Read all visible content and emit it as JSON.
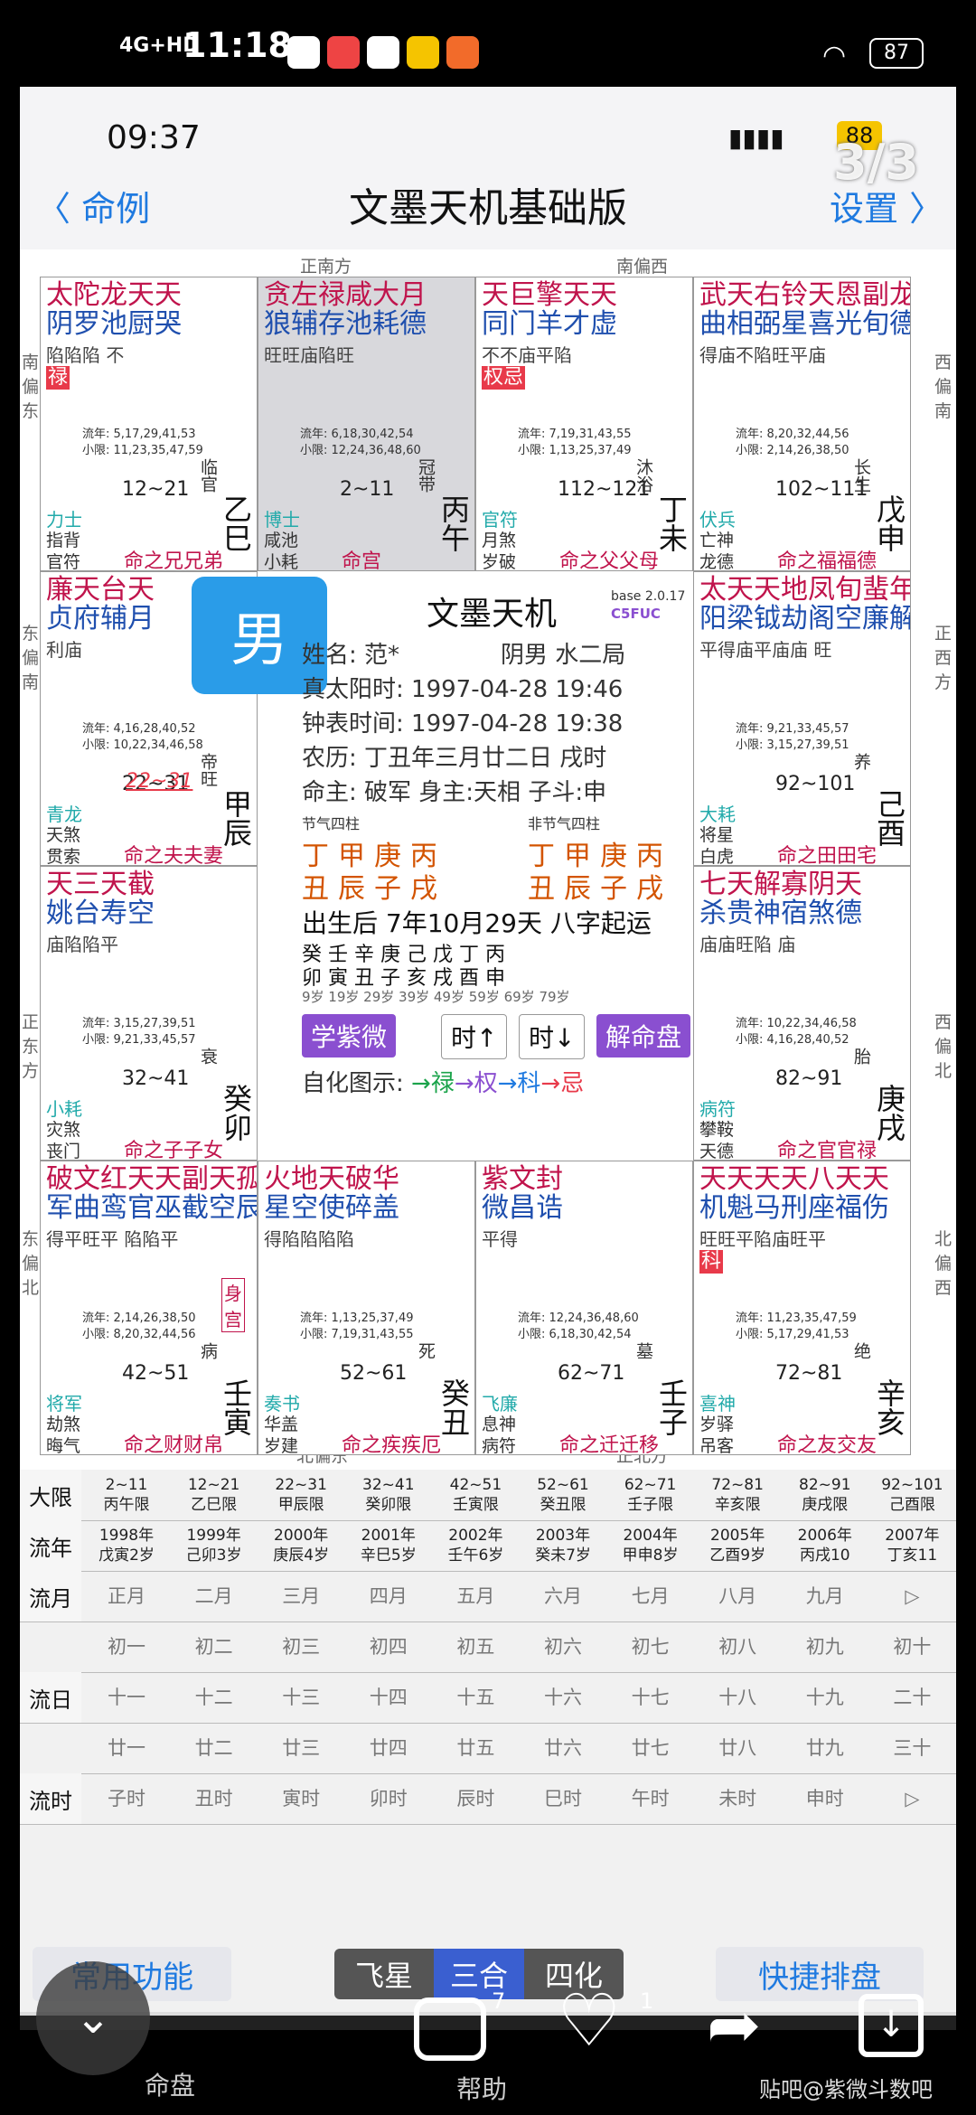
{
  "status_bar": {
    "network": "4G+HD",
    "time": "11:18",
    "battery": "87"
  },
  "inner_status": {
    "time": "09:37",
    "battery": "88",
    "page_counter": "3/3"
  },
  "nav": {
    "back_label": "命例",
    "title": "文墨天机基础版",
    "settings_label": "设置"
  },
  "directions": {
    "top_left": "正南方",
    "top_right": "南偏西",
    "left_top": "南偏东",
    "right_top": "西偏南",
    "left_mid_top": "东偏南",
    "right_mid_top": "正西方",
    "left_mid_bottom": "正东方",
    "right_mid_bottom": "西偏北",
    "left_bottom": "东偏北",
    "right_bottom": "北偏西",
    "bottom_left": "北偏东",
    "bottom_right": "正北方"
  },
  "gender_badge": "男",
  "palaces": [
    {
      "stars": "太陀龙天天",
      "stars2": "阴罗池厨哭",
      "bright": "陷陷陷   不",
      "hua": "禄",
      "y1": "流年: 5,17,29,41,53",
      "y2": "小限: 11,23,35,47,59",
      "range": "12~21",
      "g1": "力士",
      "g2": "指背",
      "g3": "官符",
      "palace": "命之兄兄弟",
      "stage": "临官",
      "sb": "乙巳"
    },
    {
      "stars": "贪左禄咸大月",
      "stars2": "狼辅存池耗德",
      "bright": "旺旺庙陷旺",
      "hua": "",
      "y1": "流年: 6,18,30,42,54",
      "y2": "小限: 12,24,36,48,60",
      "range": "2~11",
      "g1": "博士",
      "g2": "咸池",
      "g3": "小耗",
      "palace": "命宫",
      "stage": "冠带",
      "sb": "丙午"
    },
    {
      "stars": "天巨擎天天",
      "stars2": "同门羊才虚",
      "bright": "不不庙平陷",
      "hua": "权忌",
      "y1": "流年: 7,19,31,43,55",
      "y2": "小限: 1,13,25,37,49",
      "range": "112~121",
      "g1": "官符",
      "g2": "月煞",
      "g3": "岁破",
      "palace": "命之父父母",
      "stage": "沐浴",
      "sb": "丁未"
    },
    {
      "stars": "武天右铃天恩副龙",
      "stars2": "曲相弼星喜光旬德",
      "bright": "得庙不陷旺平庙",
      "hua": "",
      "y1": "流年: 8,20,32,44,56",
      "y2": "小限: 2,14,26,38,50",
      "range": "102~111",
      "g1": "伏兵",
      "g2": "亡神",
      "g3": "龙德",
      "palace": "命之福福德",
      "stage": "长生",
      "sb": "戊申"
    },
    {
      "stars": "廉天台天",
      "stars2": "贞府辅月",
      "bright": "利庙",
      "hua": "",
      "y1": "流年: 4,16,28,40,52",
      "y2": "小限: 10,22,34,46,58",
      "range": "22~31",
      "g1": "青龙",
      "g2": "天煞",
      "g3": "贯索",
      "palace": "命之夫夫妻",
      "stage": "帝旺",
      "sb": "甲辰"
    },
    {
      "stars": "太天天地凤旬蜚年",
      "stars2": "阳梁钺劫阁空廉解",
      "bright": "平得庙平庙庙   旺",
      "hua": "",
      "y1": "流年: 9,21,33,45,57",
      "y2": "小限: 3,15,27,39,51",
      "range": "92~101",
      "g1": "大耗",
      "g2": "将星",
      "g3": "白虎",
      "palace": "命之田田宅",
      "stage": "养",
      "sb": "己酉"
    },
    {
      "stars": "天三天截",
      "stars2": "姚台寿空",
      "bright": "庙陷陷平",
      "hua": "",
      "y1": "流年: 3,15,27,39,51",
      "y2": "小限: 9,21,33,45,57",
      "range": "32~41",
      "g1": "小耗",
      "g2": "灾煞",
      "g3": "丧门",
      "palace": "命之子子女",
      "stage": "衰",
      "sb": "癸卯"
    },
    {
      "stars": "七天解寡阴天",
      "stars2": "杀贵神宿煞德",
      "bright": "庙庙旺陷   庙",
      "hua": "",
      "y1": "流年: 10,22,34,46,58",
      "y2": "小限: 4,16,28,40,52",
      "range": "82~91",
      "g1": "病符",
      "g2": "攀鞍",
      "g3": "天德",
      "palace": "命之官官禄",
      "stage": "胎",
      "sb": "庚戌"
    },
    {
      "stars": "破文红天天副天孤劫",
      "stars2": "军曲鸾官巫截空辰煞",
      "bright": "得平旺平   陷陷平",
      "hua": "",
      "y1": "流年: 2,14,26,38,50",
      "y2": "小限: 8,20,32,44,56",
      "range": "42~51",
      "g1": "将军",
      "g2": "劫煞",
      "g3": "晦气",
      "palace": "命之财财帛",
      "stage": "病",
      "sb": "壬寅"
    },
    {
      "stars": "火地天破华",
      "stars2": "星空使碎盖",
      "bright": "得陷陷陷陷",
      "hua": "",
      "y1": "流年: 1,13,25,37,49",
      "y2": "小限: 7,19,31,43,55",
      "range": "52~61",
      "g1": "奏书",
      "g2": "华盖",
      "g3": "岁建",
      "palace": "命之疾疾厄",
      "stage": "死",
      "sb": "癸丑"
    },
    {
      "stars": "紫文封",
      "stars2": "微昌诰",
      "bright": "平得",
      "hua": "",
      "y1": "流年: 12,24,36,48,60",
      "y2": "小限: 6,18,30,42,54",
      "range": "62~71",
      "g1": "飞廉",
      "g2": "息神",
      "g3": "病符",
      "palace": "命之迁迁移",
      "stage": "墓",
      "sb": "壬子"
    },
    {
      "stars": "天天天天八天天",
      "stars2": "机魁马刑座福伤",
      "bright": "旺旺平陷庙旺平",
      "hua": "科",
      "y1": "流年: 11,23,35,47,59",
      "y2": "小限: 5,17,29,41,53",
      "range": "72~81",
      "g1": "喜神",
      "g2": "岁驿",
      "g3": "吊客",
      "palace": "命之友交友",
      "stage": "绝",
      "sb": "辛亥"
    }
  ],
  "shen_gong": "身宫",
  "daxian_marker": "22~31",
  "center": {
    "app": "文墨天机",
    "version": "base 2.0.17",
    "code": "C5FUC",
    "name": "姓名: 范*",
    "yinyang": "阴男 水二局",
    "true_solar": "真太阳时: 1997-04-28  19:46",
    "clock": "钟表时间: 1997-04-28  19:38",
    "lunar": "农历: 丁丑年三月廿二日 戌时",
    "master": "命主: 破军 身主:天相  子斗:申",
    "pillars_title_left": "节气四柱",
    "pillars_title_right": "非节气四柱",
    "pillars_top": "丁甲庚丙",
    "pillars_bottom": "丑辰子戌",
    "pillars2_top": "丁甲庚丙",
    "pillars2_bottom": "丑辰子戌",
    "luck_start": "出生后 7年10月29天 八字起运",
    "luck_row_top": "癸 壬 辛 庚 己 戊 丁 丙",
    "luck_row_bottom": "卯 寅 丑 子 亥 戌 酉 申",
    "luck_ages": "9岁  19岁  29岁  39岁  49岁  59岁  69岁  79岁",
    "btn_learn": "学紫微",
    "btn_up": "时↑",
    "btn_down": "时↓",
    "btn_decode": "解命盘",
    "legend_label": "自化图示:",
    "legend_lu": "→禄",
    "legend_quan": "→权",
    "legend_ke": "→科",
    "legend_ji": "→忌"
  },
  "table": {
    "daxian_label": "大限",
    "daxian": [
      [
        "2~11",
        "丙午限"
      ],
      [
        "12~21",
        "乙巳限"
      ],
      [
        "22~31",
        "甲辰限"
      ],
      [
        "32~41",
        "癸卯限"
      ],
      [
        "42~51",
        "壬寅限"
      ],
      [
        "52~61",
        "癸丑限"
      ],
      [
        "62~71",
        "壬子限"
      ],
      [
        "72~81",
        "辛亥限"
      ],
      [
        "82~91",
        "庚戌限"
      ],
      [
        "92~101",
        "己酉限"
      ]
    ],
    "liunian_label": "流年",
    "liunian": [
      [
        "1998年",
        "戊寅2岁"
      ],
      [
        "1999年",
        "己卯3岁"
      ],
      [
        "2000年",
        "庚辰4岁"
      ],
      [
        "2001年",
        "辛巳5岁"
      ],
      [
        "2002年",
        "壬午6岁"
      ],
      [
        "2003年",
        "癸未7岁"
      ],
      [
        "2004年",
        "甲申8岁"
      ],
      [
        "2005年",
        "乙酉9岁"
      ],
      [
        "2006年",
        "丙戌10"
      ],
      [
        "2007年",
        "丁亥11"
      ]
    ],
    "liuyue_label": "流月",
    "liuyue": [
      "正月",
      "二月",
      "三月",
      "四月",
      "五月",
      "六月",
      "七月",
      "八月",
      "九月",
      "▷"
    ],
    "liuri_label": "流日",
    "liuri_1": [
      "初一",
      "初二",
      "初三",
      "初四",
      "初五",
      "初六",
      "初七",
      "初八",
      "初九",
      "初十"
    ],
    "liuri_2": [
      "十一",
      "十二",
      "十三",
      "十四",
      "十五",
      "十六",
      "十七",
      "十八",
      "十九",
      "二十"
    ],
    "liuri_3": [
      "廿一",
      "廿二",
      "廿三",
      "廿四",
      "廿五",
      "廿六",
      "廿七",
      "廿八",
      "廿九",
      "三十"
    ],
    "liushi_label": "流时",
    "liushi": [
      "子时",
      "丑时",
      "寅时",
      "卯时",
      "辰时",
      "巳时",
      "午时",
      "未时",
      "申时",
      "▷"
    ]
  },
  "bottom": {
    "common": "常用功能",
    "quick": "快捷排盘",
    "seg1": "飞星",
    "seg2": "三合",
    "seg3": "四化",
    "tab1": "命盘",
    "tab2": "帮助"
  },
  "overlay": {
    "comments": "7",
    "likes": "1",
    "watermark": "贴吧@紫微斗数吧"
  }
}
